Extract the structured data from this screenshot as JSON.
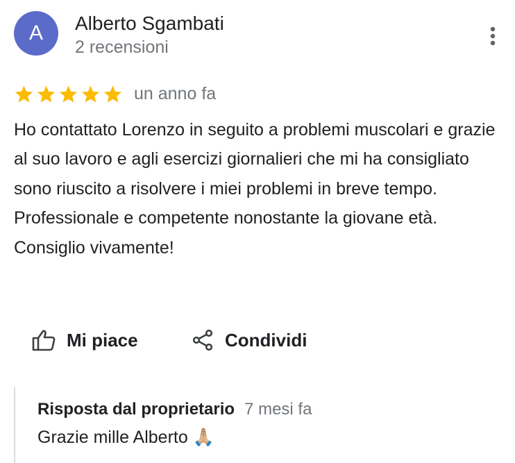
{
  "reviewer": {
    "initial": "A",
    "name": "Alberto Sgambati",
    "meta": "2 recensioni",
    "avatar_color": "#5b6bc9"
  },
  "review": {
    "rating": 5,
    "max_rating": 5,
    "star_color": "#fbbc04",
    "date": "un anno fa",
    "text": "Ho contattato Lorenzo in seguito a problemi muscolari e grazie al suo lavoro e agli esercizi giornalieri che mi ha consigliato sono riuscito a risolvere i miei problemi in breve tempo. Professionale e competente nonostante la giovane età.\nConsiglio vivamente!"
  },
  "actions": {
    "like_label": "Mi piace",
    "like_icon": "thumb-up-icon",
    "share_label": "Condividi",
    "share_icon": "share-icon",
    "more_icon": "more-vert-icon"
  },
  "owner_response": {
    "title": "Risposta dal proprietario",
    "date": "7 mesi fa",
    "text": "Grazie mille Alberto 🙏🏼"
  }
}
